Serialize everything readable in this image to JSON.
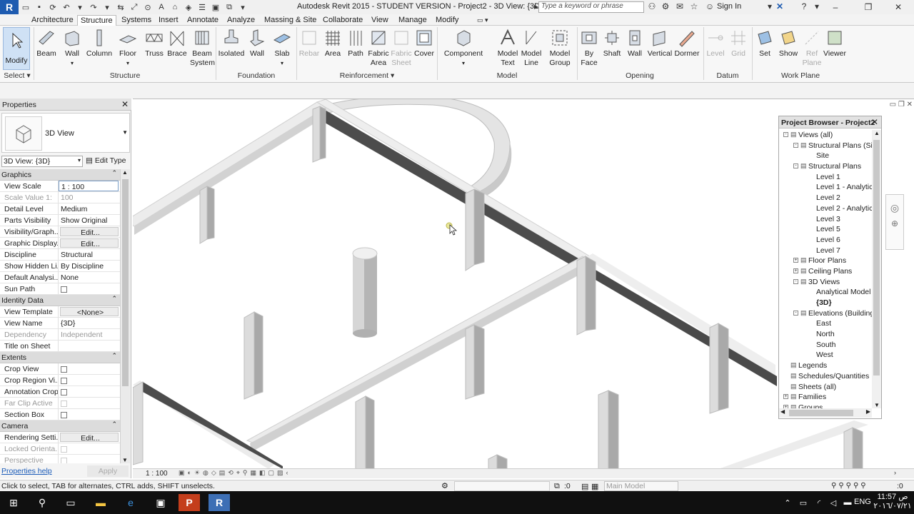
{
  "titlebar": {
    "title": "Autodesk Revit 2015 -  STUDENT VERSION -      Project2 - 3D View: {3D}",
    "search_placeholder": "Type a keyword or phrase",
    "signin": "Sign In",
    "app_letter": "R"
  },
  "ribbon_tabs": [
    "Architecture",
    "Structure",
    "Systems",
    "Insert",
    "Annotate",
    "Analyze",
    "Massing & Site",
    "Collaborate",
    "View",
    "Manage",
    "Modify"
  ],
  "active_tab": "Structure",
  "ribbon": {
    "modify": "Modify",
    "select": "Select",
    "structure": [
      "Beam",
      "Wall",
      "Column",
      "Floor",
      "Truss",
      "Brace",
      "Beam System"
    ],
    "foundation": [
      "Isolated",
      "Wall",
      "Slab"
    ],
    "reinforcement": [
      "Rebar",
      "Area",
      "Path",
      "Fabric Area",
      "Fabric Sheet",
      "Cover"
    ],
    "component": "Component",
    "model": [
      "Model Text",
      "Model Line",
      "Model Group"
    ],
    "opening": [
      "By Face",
      "Shaft",
      "Wall",
      "Vertical",
      "Dormer"
    ],
    "datum": [
      "Level",
      "Grid"
    ],
    "workplane": [
      "Set",
      "Show",
      "Ref Plane",
      "Viewer"
    ],
    "panels": [
      "Structure",
      "Foundation",
      "Reinforcement",
      "Model",
      "Opening",
      "Datum",
      "Work Plane"
    ]
  },
  "properties": {
    "title": "Properties",
    "type_name": "3D View",
    "instance": "3D View: {3D}",
    "edit_type": "Edit Type",
    "groups": [
      {
        "name": "Graphics",
        "rows": [
          {
            "n": "View Scale",
            "v": "1 : 100",
            "kind": "input"
          },
          {
            "n": "Scale Value    1:",
            "v": "100",
            "kind": "ro"
          },
          {
            "n": "Detail Level",
            "v": "Medium",
            "kind": "text"
          },
          {
            "n": "Parts Visibility",
            "v": "Show Original",
            "kind": "text"
          },
          {
            "n": "Visibility/Graph...",
            "v": "Edit...",
            "kind": "button"
          },
          {
            "n": "Graphic Display...",
            "v": "Edit...",
            "kind": "button"
          },
          {
            "n": "Discipline",
            "v": "Structural",
            "kind": "text"
          },
          {
            "n": "Show Hidden Li...",
            "v": "By Discipline",
            "kind": "text"
          },
          {
            "n": "Default Analysi...",
            "v": "None",
            "kind": "text"
          },
          {
            "n": "Sun Path",
            "v": "",
            "kind": "check"
          }
        ]
      },
      {
        "name": "Identity Data",
        "rows": [
          {
            "n": "View Template",
            "v": "<None>",
            "kind": "button"
          },
          {
            "n": "View Name",
            "v": "{3D}",
            "kind": "text"
          },
          {
            "n": "Dependency",
            "v": "Independent",
            "kind": "ro"
          },
          {
            "n": "Title on Sheet",
            "v": "",
            "kind": "text"
          }
        ]
      },
      {
        "name": "Extents",
        "rows": [
          {
            "n": "Crop View",
            "v": "",
            "kind": "check"
          },
          {
            "n": "Crop Region Vi...",
            "v": "",
            "kind": "check"
          },
          {
            "n": "Annotation Crop",
            "v": "",
            "kind": "check"
          },
          {
            "n": "Far Clip Active",
            "v": "",
            "kind": "rocheck"
          },
          {
            "n": "Section Box",
            "v": "",
            "kind": "check"
          }
        ]
      },
      {
        "name": "Camera",
        "rows": [
          {
            "n": "Rendering Setti...",
            "v": "Edit...",
            "kind": "button"
          },
          {
            "n": "Locked Orienta...",
            "v": "",
            "kind": "rocheck"
          },
          {
            "n": "Perspective",
            "v": "",
            "kind": "rocheck"
          }
        ]
      }
    ],
    "help": "Properties help",
    "apply": "Apply"
  },
  "browser": {
    "title": "Project Browser - Project2",
    "nodes": [
      {
        "label": "Views (all)",
        "level": 0,
        "exp": "-"
      },
      {
        "label": "Structural Plans (Site",
        "level": 1,
        "exp": "-"
      },
      {
        "label": "Site",
        "level": 2,
        "exp": ""
      },
      {
        "label": "Structural Plans",
        "level": 1,
        "exp": "-"
      },
      {
        "label": "Level 1",
        "level": 2,
        "exp": ""
      },
      {
        "label": "Level 1 - Analytica",
        "level": 2,
        "exp": ""
      },
      {
        "label": "Level 2",
        "level": 2,
        "exp": ""
      },
      {
        "label": "Level 2 - Analytica",
        "level": 2,
        "exp": ""
      },
      {
        "label": "Level 3",
        "level": 2,
        "exp": ""
      },
      {
        "label": "Level 5",
        "level": 2,
        "exp": ""
      },
      {
        "label": "Level 6",
        "level": 2,
        "exp": ""
      },
      {
        "label": "Level 7",
        "level": 2,
        "exp": ""
      },
      {
        "label": "Floor Plans",
        "level": 1,
        "exp": "+"
      },
      {
        "label": "Ceiling Plans",
        "level": 1,
        "exp": "+"
      },
      {
        "label": "3D Views",
        "level": 1,
        "exp": "-"
      },
      {
        "label": "Analytical Model",
        "level": 2,
        "exp": ""
      },
      {
        "label": "{3D}",
        "level": 2,
        "exp": "",
        "bold": true
      },
      {
        "label": "Elevations (Building E",
        "level": 1,
        "exp": "-"
      },
      {
        "label": "East",
        "level": 2,
        "exp": ""
      },
      {
        "label": "North",
        "level": 2,
        "exp": ""
      },
      {
        "label": "South",
        "level": 2,
        "exp": ""
      },
      {
        "label": "West",
        "level": 2,
        "exp": ""
      },
      {
        "label": "Legends",
        "level": 0,
        "exp": ""
      },
      {
        "label": "Schedules/Quantities",
        "level": 0,
        "exp": ""
      },
      {
        "label": "Sheets (all)",
        "level": 0,
        "exp": ""
      },
      {
        "label": "Families",
        "level": 0,
        "exp": "+"
      },
      {
        "label": "Groups",
        "level": 0,
        "exp": "+"
      }
    ]
  },
  "viewbar": {
    "scale": "1 : 100"
  },
  "status": {
    "text": "Click to select, TAB for alternates, CTRL adds, SHIFT unselects.",
    "zero1": ":0",
    "workset": "Main Model",
    "zero2": ":0"
  },
  "taskbar": {
    "time": "11:57 ص",
    "date": "٢٠١٦/٠٧/٢١",
    "lang": "ENG"
  },
  "colors": {
    "accent": "#1e5bb0",
    "beam_top": "#ebebeb",
    "beam_side": "#4a4a4a"
  }
}
